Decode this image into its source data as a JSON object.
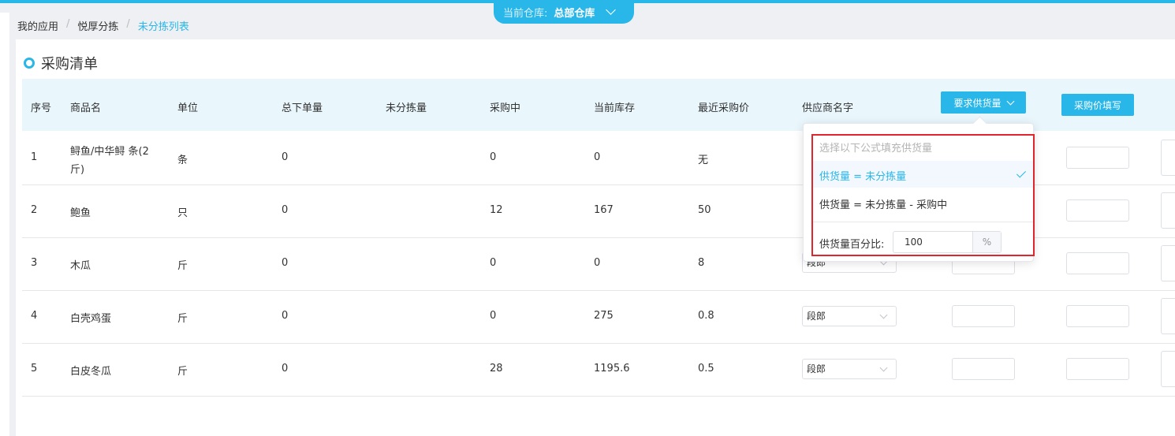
{
  "header": {
    "warehouse_label": "当前仓库:",
    "warehouse_value": "总部仓库"
  },
  "breadcrumb": [
    "我的应用",
    "悦厚分拣",
    "未分拣列表"
  ],
  "page_title": "采购清单",
  "table": {
    "columns": [
      "序号",
      "商品名",
      "单位",
      "总下单量",
      "未分拣量",
      "采购中",
      "当前库存",
      "最近采购价",
      "供应商名字"
    ],
    "supply_button": "要求供货量",
    "price_button": "采购价填写",
    "rows": [
      {
        "no": "1",
        "name": "鲟鱼/中华鲟 条(2",
        "name2": "斤)",
        "unit": "条",
        "total": "0",
        "unsorted": "",
        "purchasing": "0",
        "stock": "0",
        "price": "无",
        "supplier": ""
      },
      {
        "no": "2",
        "name": "鲍鱼",
        "name2": "",
        "unit": "只",
        "total": "0",
        "unsorted": "",
        "purchasing": "12",
        "stock": "167",
        "price": "50",
        "supplier": ""
      },
      {
        "no": "3",
        "name": "木瓜",
        "name2": "",
        "unit": "斤",
        "total": "0",
        "unsorted": "",
        "purchasing": "0",
        "stock": "0",
        "price": "8",
        "supplier": "段郎"
      },
      {
        "no": "4",
        "name": "白壳鸡蛋",
        "name2": "",
        "unit": "斤",
        "total": "0",
        "unsorted": "",
        "purchasing": "0",
        "stock": "275",
        "price": "0.8",
        "supplier": "段郎"
      },
      {
        "no": "5",
        "name": "白皮冬瓜",
        "name2": "",
        "unit": "斤",
        "total": "0",
        "unsorted": "",
        "purchasing": "28",
        "stock": "1195.6",
        "price": "0.5",
        "supplier": "段郎"
      }
    ]
  },
  "dropdown": {
    "hint": "选择以下公式填充供货量",
    "option1": "供货量 = 未分拣量",
    "option2": "供货量 = 未分拣量 - 采购中",
    "percent_label": "供货量百分比:",
    "percent_value": "100",
    "percent_unit": "%"
  },
  "colors": {
    "accent": "#29b6e8",
    "highlight_border": "#e0262c"
  }
}
